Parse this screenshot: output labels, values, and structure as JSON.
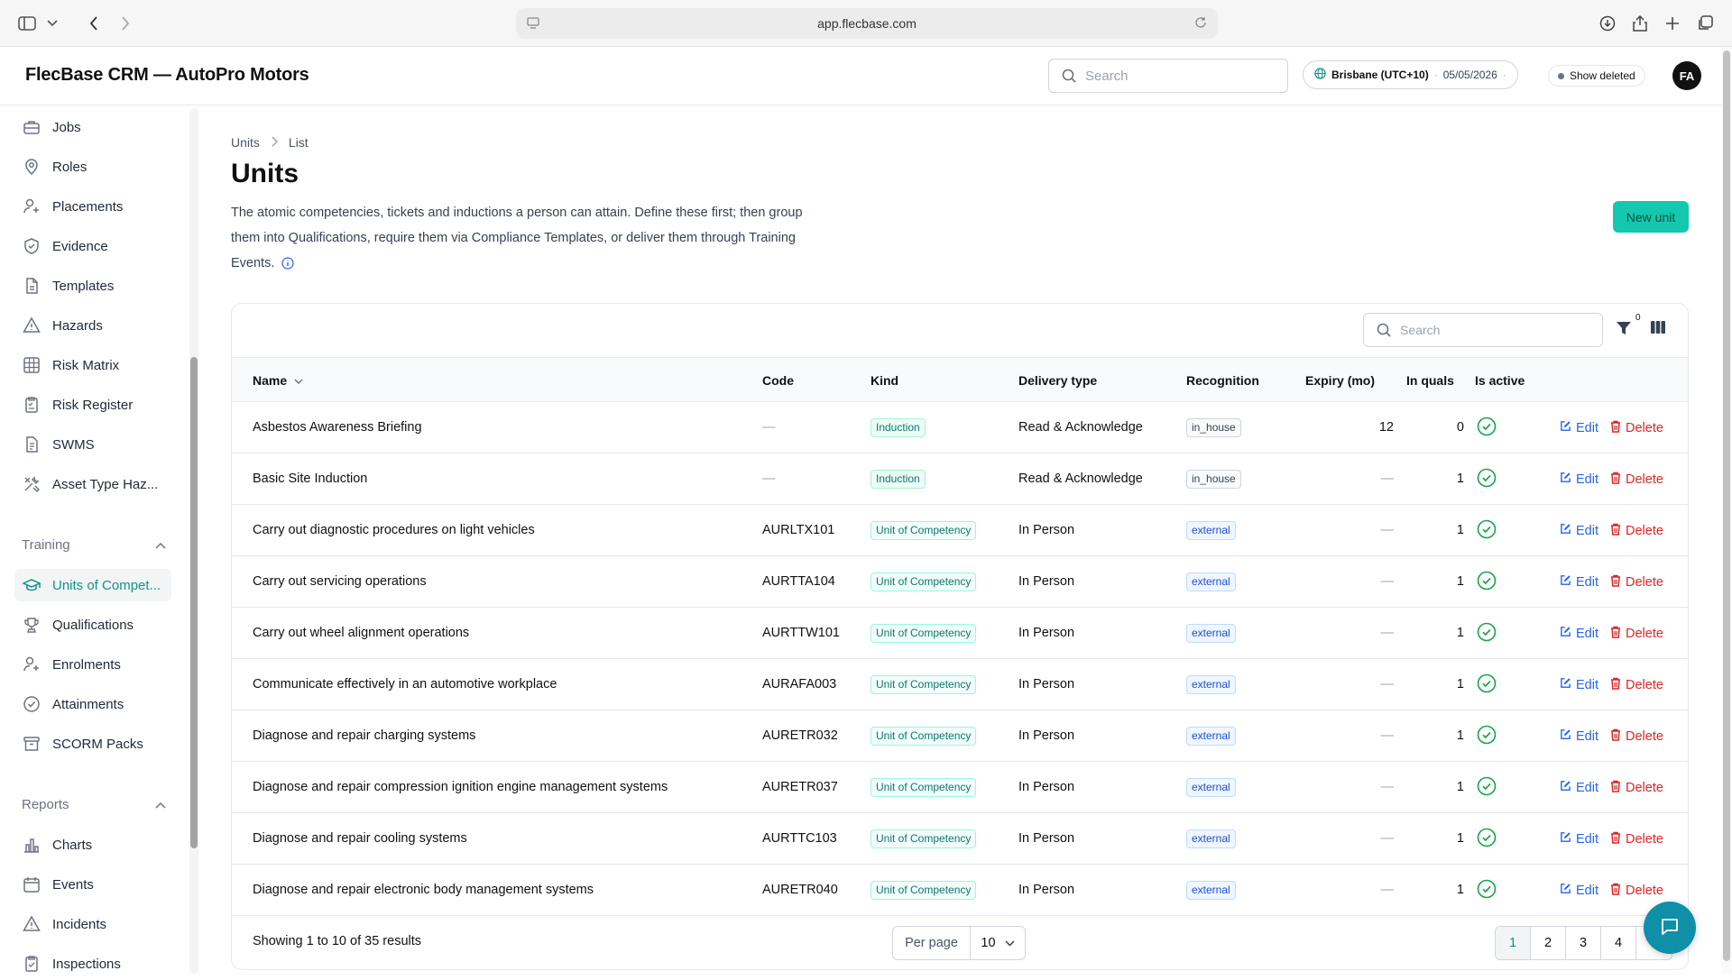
{
  "browser": {
    "url": "app.flecbase.com"
  },
  "header": {
    "app_title": "FlecBase CRM — AutoPro Motors",
    "search_placeholder": "Search",
    "timezone": "Brisbane (UTC+10)",
    "date": "05/05/2026",
    "show_deleted": "Show deleted",
    "avatar_initials": "FA"
  },
  "sidebar": {
    "items_top": [
      {
        "label": "Jobs",
        "icon": "briefcase-icon"
      },
      {
        "label": "Roles",
        "icon": "pin-icon"
      },
      {
        "label": "Placements",
        "icon": "user-plus-icon"
      },
      {
        "label": "Evidence",
        "icon": "shield-check-icon"
      },
      {
        "label": "Templates",
        "icon": "file-icon"
      },
      {
        "label": "Hazards",
        "icon": "warning-icon"
      },
      {
        "label": "Risk Matrix",
        "icon": "grid-icon"
      },
      {
        "label": "Risk Register",
        "icon": "clipboard-icon"
      },
      {
        "label": "SWMS",
        "icon": "document-icon"
      },
      {
        "label": "Asset Type Haz...",
        "icon": "tools-icon"
      }
    ],
    "training_group": "Training",
    "training_items": [
      {
        "label": "Units of Compet...",
        "icon": "graduation-cap-icon",
        "active": true
      },
      {
        "label": "Qualifications",
        "icon": "trophy-icon"
      },
      {
        "label": "Enrolments",
        "icon": "user-plus-icon"
      },
      {
        "label": "Attainments",
        "icon": "check-circle-icon"
      },
      {
        "label": "SCORM Packs",
        "icon": "archive-icon"
      }
    ],
    "reports_group": "Reports",
    "reports_items": [
      {
        "label": "Charts",
        "icon": "bar-chart-icon"
      },
      {
        "label": "Events",
        "icon": "calendar-icon"
      },
      {
        "label": "Incidents",
        "icon": "alert-icon"
      },
      {
        "label": "Inspections",
        "icon": "clipboard-check-icon"
      }
    ]
  },
  "page": {
    "breadcrumb": [
      "Units",
      "List"
    ],
    "title": "Units",
    "description": "The atomic competencies, tickets and inductions a person can attain. Define these first; then group them into Qualifications, require them via Compliance Templates, or deliver them through Training Events.",
    "new_button": "New unit"
  },
  "table": {
    "search_placeholder": "Search",
    "filter_count": "0",
    "columns": {
      "name": "Name",
      "code": "Code",
      "kind": "Kind",
      "delivery": "Delivery type",
      "recognition": "Recognition",
      "expiry": "Expiry (mo)",
      "in_quals": "In quals",
      "is_active": "Is active"
    },
    "edit_label": "Edit",
    "delete_label": "Delete",
    "rows": [
      {
        "name": "Asbestos Awareness Briefing",
        "code": "—",
        "kind": "Induction",
        "delivery": "Read & Acknowledge",
        "recognition": "in_house",
        "expiry": "12",
        "in_quals": "0",
        "active": true
      },
      {
        "name": "Basic Site Induction",
        "code": "—",
        "kind": "Induction",
        "delivery": "Read & Acknowledge",
        "recognition": "in_house",
        "expiry": "—",
        "in_quals": "1",
        "active": true
      },
      {
        "name": "Carry out diagnostic procedures on light vehicles",
        "code": "AURLTX101",
        "kind": "Unit of Competency",
        "delivery": "In Person",
        "recognition": "external",
        "expiry": "—",
        "in_quals": "1",
        "active": true
      },
      {
        "name": "Carry out servicing operations",
        "code": "AURTTA104",
        "kind": "Unit of Competency",
        "delivery": "In Person",
        "recognition": "external",
        "expiry": "—",
        "in_quals": "1",
        "active": true
      },
      {
        "name": "Carry out wheel alignment operations",
        "code": "AURTTW101",
        "kind": "Unit of Competency",
        "delivery": "In Person",
        "recognition": "external",
        "expiry": "—",
        "in_quals": "1",
        "active": true
      },
      {
        "name": "Communicate effectively in an automotive workplace",
        "code": "AURAFA003",
        "kind": "Unit of Competency",
        "delivery": "In Person",
        "recognition": "external",
        "expiry": "—",
        "in_quals": "1",
        "active": true
      },
      {
        "name": "Diagnose and repair charging systems",
        "code": "AURETR032",
        "kind": "Unit of Competency",
        "delivery": "In Person",
        "recognition": "external",
        "expiry": "—",
        "in_quals": "1",
        "active": true
      },
      {
        "name": "Diagnose and repair compression ignition engine management systems",
        "code": "AURETR037",
        "kind": "Unit of Competency",
        "delivery": "In Person",
        "recognition": "external",
        "expiry": "—",
        "in_quals": "1",
        "active": true
      },
      {
        "name": "Diagnose and repair cooling systems",
        "code": "AURTTC103",
        "kind": "Unit of Competency",
        "delivery": "In Person",
        "recognition": "external",
        "expiry": "—",
        "in_quals": "1",
        "active": true
      },
      {
        "name": "Diagnose and repair electronic body management systems",
        "code": "AURETR040",
        "kind": "Unit of Competency",
        "delivery": "In Person",
        "recognition": "external",
        "expiry": "—",
        "in_quals": "1",
        "active": true
      }
    ],
    "footer": {
      "showing": "Showing 1 to 10 of 35 results",
      "per_page_label": "Per page",
      "per_page_value": "10",
      "pages": [
        "1",
        "2",
        "3",
        "4"
      ]
    }
  },
  "colors": {
    "accent": "#14c8b0",
    "active_text": "#0d9488",
    "edit": "#2563eb",
    "delete": "#dc2626",
    "active_check": "#16a34a"
  }
}
